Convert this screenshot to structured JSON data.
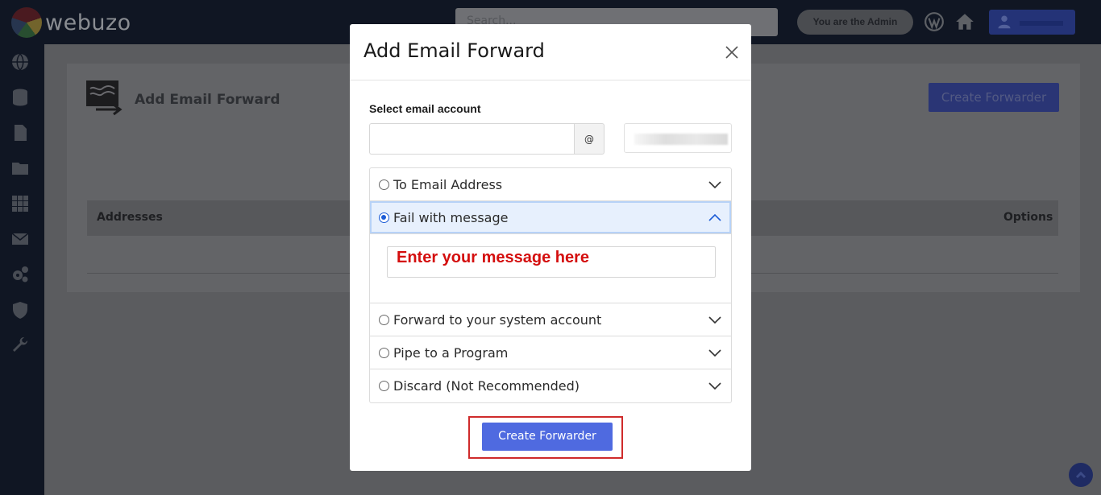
{
  "app": {
    "logo_text": "webuzo"
  },
  "topbar": {
    "search_placeholder": "Search...",
    "admin_label": "You are the Admin"
  },
  "background_page": {
    "title": "Add Email Forward",
    "create_button": "Create Forwarder",
    "table_headers": [
      "Addresses",
      "Options"
    ]
  },
  "modal": {
    "title": "Add Email Forward",
    "field_label": "Select email account",
    "at_symbol": "@",
    "options": [
      {
        "label": "To Email Address",
        "selected": false,
        "expanded": false
      },
      {
        "label": "Fail with message",
        "selected": true,
        "expanded": true
      },
      {
        "label": "Forward to your system account",
        "selected": false,
        "expanded": false
      },
      {
        "label": "Pipe to a Program",
        "selected": false,
        "expanded": false
      },
      {
        "label": "Discard (Not Recommended)",
        "selected": false,
        "expanded": false
      }
    ],
    "message_value": "Enter your message here",
    "submit_label": "Create Forwarder"
  },
  "colors": {
    "accent": "#4f6ae0",
    "message_text": "#d40e0e",
    "highlight_frame": "#cf2b2b",
    "selected_row": "#e7f0fd"
  }
}
